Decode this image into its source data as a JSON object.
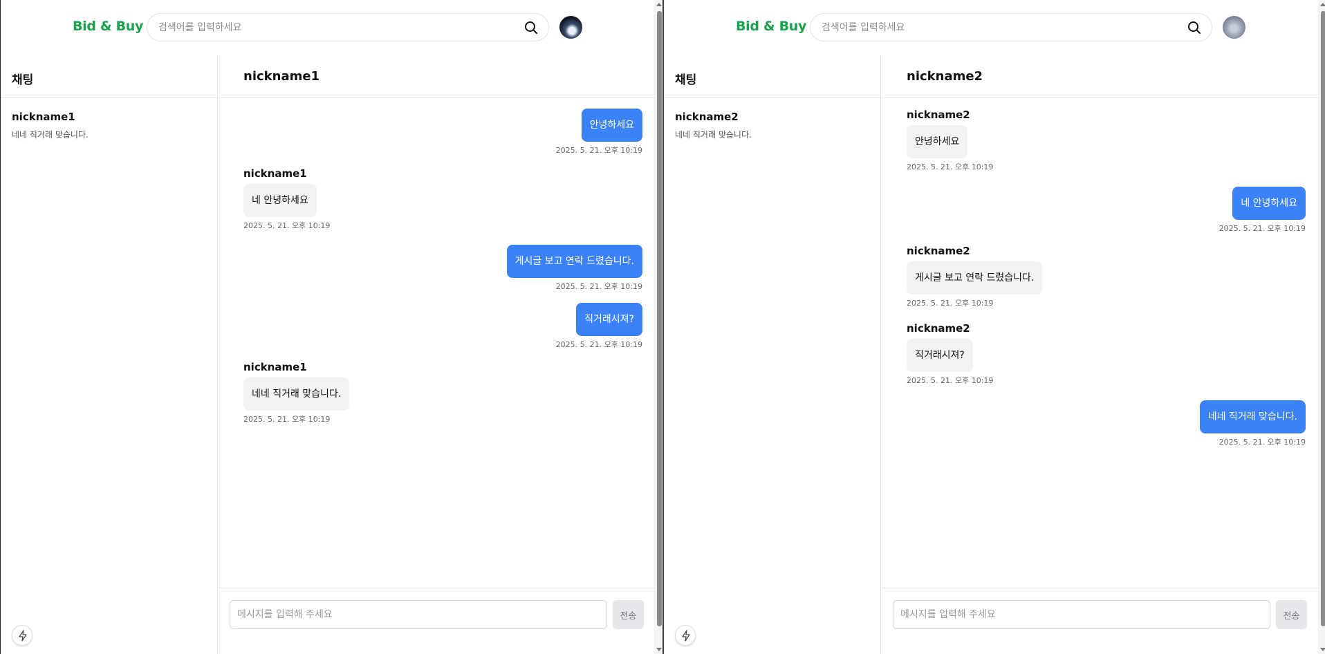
{
  "colors": {
    "brand": "#16a34a",
    "outgoing_bubble": "#3b82f6",
    "incoming_bubble": "#f2f3f5"
  },
  "panes": [
    {
      "header": {
        "logo": "Bid & Buy",
        "search_placeholder": "검색어를 입력하세요",
        "search_icon": "search-icon",
        "avatar": "user-avatar"
      },
      "sidebar": {
        "title": "채팅",
        "items": [
          {
            "name": "nickname1",
            "preview": "네네 직거래 맞습니다."
          }
        ]
      },
      "chat": {
        "title": "nickname1",
        "messages": [
          {
            "direction": "out",
            "text": "안녕하세요",
            "time": "2025. 5. 21. 오후 10:19"
          },
          {
            "direction": "in",
            "sender": "nickname1",
            "text": "네 안녕하세요",
            "time": "2025. 5. 21. 오후 10:19"
          },
          {
            "direction": "out",
            "text": "게시글 보고 연락 드렸습니다.",
            "time": "2025. 5. 21. 오후 10:19"
          },
          {
            "direction": "out",
            "text": "직거래시져?",
            "time": "2025. 5. 21. 오후 10:19"
          },
          {
            "direction": "in",
            "sender": "nickname1",
            "text": "네네 직거래 맞습니다.",
            "time": "2025. 5. 21. 오후 10:19"
          }
        ],
        "input_placeholder": "메시지를 입력해 주세요",
        "send_label": "전송"
      },
      "fab_icon": "lightning-icon"
    },
    {
      "header": {
        "logo": "Bid & Buy",
        "search_placeholder": "검색어를 입력하세요",
        "search_icon": "search-icon",
        "avatar": "user-avatar"
      },
      "sidebar": {
        "title": "채팅",
        "items": [
          {
            "name": "nickname2",
            "preview": "네네 직거래 맞습니다."
          }
        ]
      },
      "chat": {
        "title": "nickname2",
        "messages": [
          {
            "direction": "in",
            "sender": "nickname2",
            "text": "안녕하세요",
            "time": "2025. 5. 21. 오후 10:19"
          },
          {
            "direction": "out",
            "text": "네 안녕하세요",
            "time": "2025. 5. 21. 오후 10:19"
          },
          {
            "direction": "in",
            "sender": "nickname2",
            "text": "게시글 보고 연락 드렸습니다.",
            "time": "2025. 5. 21. 오후 10:19"
          },
          {
            "direction": "in",
            "sender": "nickname2",
            "text": "직거래시져?",
            "time": "2025. 5. 21. 오후 10:19"
          },
          {
            "direction": "out",
            "text": "네네 직거래 맞습니다.",
            "time": "2025. 5. 21. 오후 10:19"
          }
        ],
        "input_placeholder": "메시지를 입력해 주세요",
        "send_label": "전송"
      },
      "fab_icon": "lightning-icon"
    }
  ]
}
